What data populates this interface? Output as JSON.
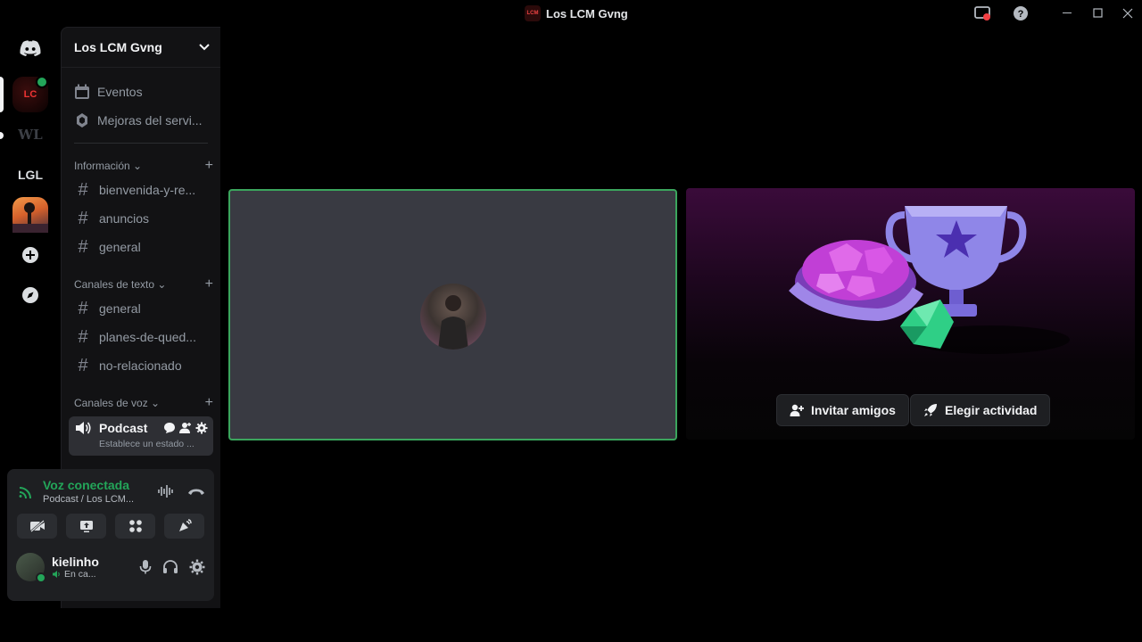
{
  "window": {
    "title": "Los LCM Gvng",
    "controls": [
      "minimize",
      "maximize",
      "close"
    ]
  },
  "rail": {
    "servers": [
      {
        "name": "home",
        "icon": "discord-icon"
      },
      {
        "name": "Los LCM Gvng",
        "icon": "lcm-server-icon",
        "active": true,
        "in_voice": true
      },
      {
        "name": "WL",
        "icon": "wl-server-icon"
      },
      {
        "name": "LGL",
        "label": "LGL"
      },
      {
        "name": "server-image",
        "icon": "sunset-server-icon"
      },
      {
        "name": "add-server",
        "icon": "plus-icon"
      },
      {
        "name": "discover",
        "icon": "compass-icon"
      }
    ]
  },
  "sidebar": {
    "guild_name": "Los LCM Gvng",
    "top_items": [
      {
        "label": "Eventos",
        "icon": "calendar-icon"
      },
      {
        "label": "Mejoras del servi...",
        "icon": "boost-icon"
      }
    ],
    "sections": [
      {
        "title": "Información",
        "channels": [
          "bienvenida-y-re...",
          "anuncios",
          "general"
        ]
      },
      {
        "title": "Canales de texto",
        "channels": [
          "general",
          "planes-de-qued...",
          "no-relacionado"
        ]
      },
      {
        "title": "Canales de voz"
      }
    ],
    "voice_channel": {
      "name": "Podcast",
      "status": "Establece un estado ..."
    }
  },
  "panel": {
    "voice_title": "Voz conectada",
    "voice_sub": "Podcast / Los LCM...",
    "user_name": "kielinho",
    "user_status": "En ca..."
  },
  "stage": {
    "invite_label": "Invitar amigos",
    "activity_label": "Elegir actividad"
  },
  "colors": {
    "accent_green": "#23a559",
    "tile_border": "#3ba55d",
    "background": "#000000",
    "sidebar": "#121214"
  }
}
